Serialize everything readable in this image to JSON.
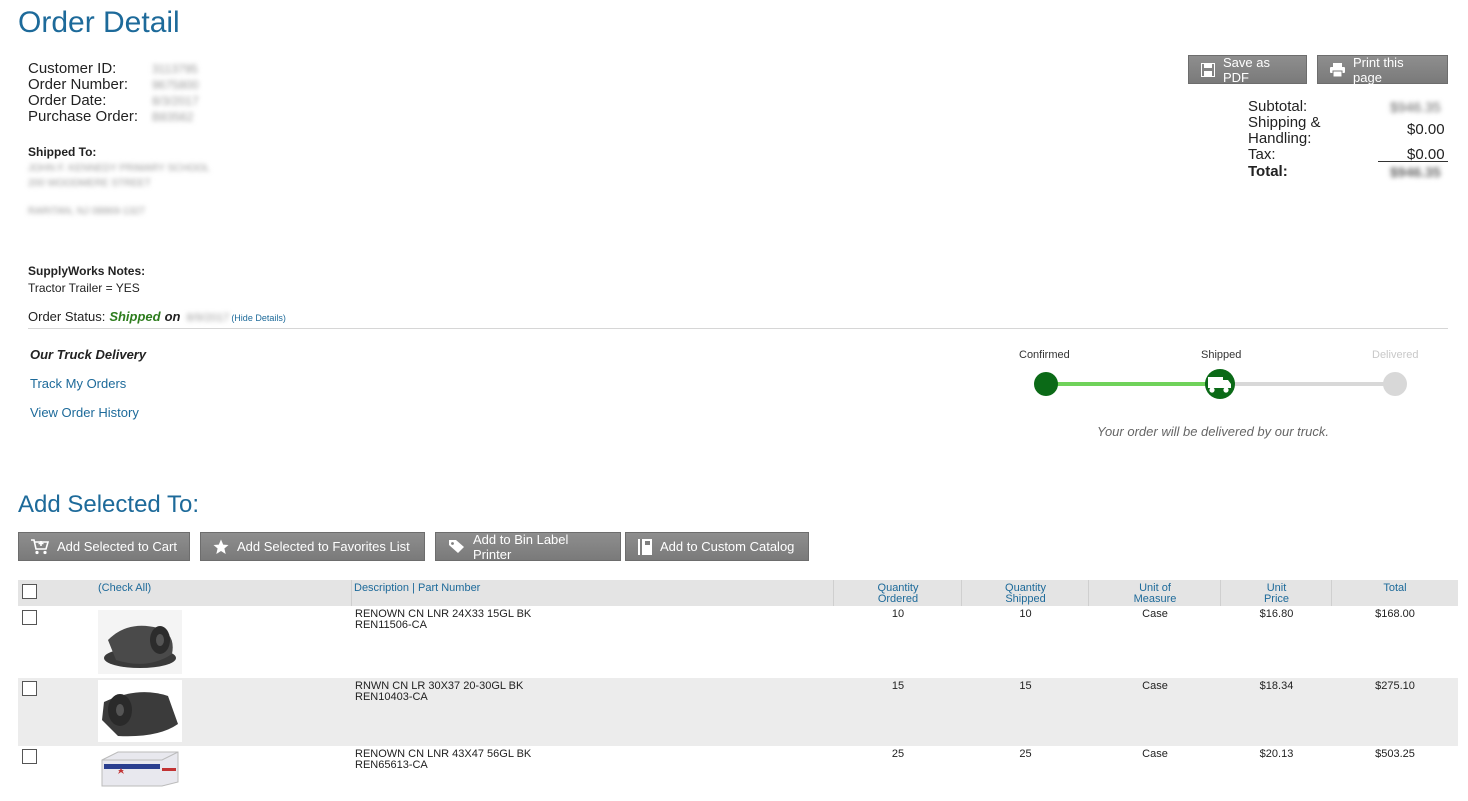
{
  "page": {
    "title": "Order Detail"
  },
  "customer": {
    "labels": [
      "Customer ID:",
      "Order Number:",
      "Order Date:",
      "Purchase Order:"
    ],
    "values": [
      "3113795",
      "9675800",
      "8/3/2017",
      "B83562"
    ]
  },
  "shipped_to": {
    "label": "Shipped To:",
    "lines": [
      "JOHN F. KENNEDY PRIMARY SCHOOL",
      "200 WOODMERE STREET",
      "RARITAN, NJ 08869-1327"
    ]
  },
  "notes": {
    "label": "SupplyWorks Notes:",
    "text": "Tractor Trailer = YES"
  },
  "status": {
    "label": "Order Status:",
    "value": "Shipped",
    "on": "on",
    "date": "8/9/2017",
    "toggle": "(Hide Details)"
  },
  "delivery": {
    "title": "Our Truck Delivery",
    "track_link": "Track My Orders",
    "history_link": "View Order History",
    "steps": [
      "Confirmed",
      "Shipped",
      "Delivered"
    ],
    "progress": 0.5,
    "message": "Your order will be delivered by our truck."
  },
  "actions": {
    "save_pdf": "Save as PDF",
    "print": "Print this page"
  },
  "totals": {
    "subtotal_label": "Subtotal:",
    "subtotal_value": "$946.35",
    "shipping_label_1": "Shipping &",
    "shipping_label_2": "Handling:",
    "shipping_value": "$0.00",
    "tax_label": "Tax:",
    "tax_value": "$0.00",
    "total_label": "Total:",
    "total_value": "$946.35"
  },
  "add_selected": {
    "heading": "Add Selected To:",
    "cart": "Add Selected to Cart",
    "favorites": "Add Selected to Favorites List",
    "bin_label": "Add to Bin Label Printer",
    "catalog": "Add to Custom Catalog"
  },
  "table": {
    "headers": {
      "check_all": "(Check All)",
      "description": "Description | Part Number",
      "qty_ordered_1": "Quantity",
      "qty_ordered_2": "Ordered",
      "qty_shipped_1": "Quantity",
      "qty_shipped_2": "Shipped",
      "uom_1": "Unit of",
      "uom_2": "Measure",
      "unit_price_1": "Unit",
      "unit_price_2": "Price",
      "total": "Total"
    },
    "rows": [
      {
        "description": "RENOWN CN LNR 24X33 15GL BK",
        "part": "REN11506-CA",
        "qty_ordered": "10",
        "qty_shipped": "10",
        "uom": "Case",
        "unit_price": "$16.80",
        "total": "$168.00"
      },
      {
        "description": "RNWN CN LR 30X37 20-30GL BK",
        "part": "REN10403-CA",
        "qty_ordered": "15",
        "qty_shipped": "15",
        "uom": "Case",
        "unit_price": "$18.34",
        "total": "$275.10"
      },
      {
        "description": "RENOWN CN LNR 43X47 56GL BK",
        "part": "REN65613-CA",
        "qty_ordered": "25",
        "qty_shipped": "25",
        "uom": "Case",
        "unit_price": "$20.13",
        "total": "$503.25"
      }
    ]
  },
  "colors": {
    "brand_blue": "#1d6a9a",
    "status_green": "#2e7d1e",
    "tracker_dark_green": "#0b6a17",
    "tracker_light_green": "#6fd25a",
    "tracker_gray": "#d8d8d8"
  }
}
